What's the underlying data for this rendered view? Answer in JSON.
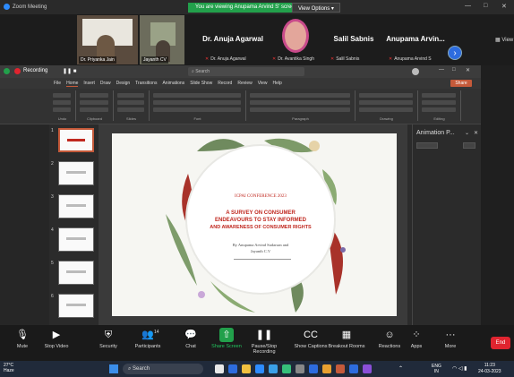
{
  "zoom": {
    "window_title": "Zoom Meeting",
    "share_banner": "You are viewing Anupama Arvind S' screen",
    "view_options": "View Options",
    "view_toggle": "View",
    "next_page": "›"
  },
  "participants": [
    {
      "name": "Dr. Priyanka Jain"
    },
    {
      "name": "Jayanth CV"
    },
    {
      "big": "Dr. Anuja Agarwal",
      "sub": "Dr. Anuja Agarwal"
    },
    {
      "sub": "Dr. Avantika Singh"
    },
    {
      "big": "Salil Sabnis",
      "sub": "Salil Sabnis"
    },
    {
      "big": "Anupama Arvin...",
      "sub": "Anupama Arvind S"
    }
  ],
  "ppt": {
    "recording_label": "Recording",
    "search_placeholder": "Search",
    "share_label": "Share",
    "menu": [
      "File",
      "Home",
      "Insert",
      "Draw",
      "Design",
      "Transitions",
      "Animations",
      "Slide Show",
      "Record",
      "Review",
      "View",
      "Help"
    ],
    "ribbon_groups": [
      "Undo",
      "Clipboard",
      "Slides",
      "Font",
      "Paragraph",
      "Drawing",
      "Editing"
    ],
    "thumb_numbers": [
      "1",
      "2",
      "3",
      "4",
      "5",
      "6"
    ],
    "animation_pane_title": "Animation P...",
    "slide": {
      "conference": "ICPAI CONFERENCE 2023",
      "title_line1": "A SURVEY ON CONSUMER",
      "title_line2": "ENDEAVOURS TO STAY INFORMED",
      "title_line3": "AND AWARENESS OF CONSUMER RIGHTS",
      "authors_line1": "By Anupama Arvind Sudarsan and",
      "authors_line2": "Jayanth C.V"
    }
  },
  "controls": [
    {
      "label": "Mute",
      "icon": "microphone-icon"
    },
    {
      "label": "Stop Video",
      "icon": "video-camera-icon"
    },
    {
      "label": "Security",
      "icon": "shield-icon"
    },
    {
      "label": "Participants",
      "icon": "people-icon",
      "count": "14"
    },
    {
      "label": "Chat",
      "icon": "chat-icon"
    },
    {
      "label": "Share Screen",
      "icon": "share-screen-icon"
    },
    {
      "label": "Pause/Stop Recording",
      "icon": "pause-icon"
    },
    {
      "label": "Show Captions",
      "icon": "captions-icon"
    },
    {
      "label": "Breakout Rooms",
      "icon": "grid-icon"
    },
    {
      "label": "Reactions",
      "icon": "smile-icon"
    },
    {
      "label": "Apps",
      "icon": "apps-icon"
    },
    {
      "label": "More",
      "icon": "more-icon"
    }
  ],
  "end_label": "End",
  "taskbar": {
    "temperature": "27°C",
    "weather": "Haze",
    "search": "Search",
    "lang": "ENG",
    "lang2": "IN",
    "time": "11:23",
    "date": "24-03-2023"
  },
  "colors": {
    "accent": "#2d8cff",
    "share_green": "#22a04b",
    "end_red": "#e0242f",
    "slide_title": "#c0281f"
  }
}
